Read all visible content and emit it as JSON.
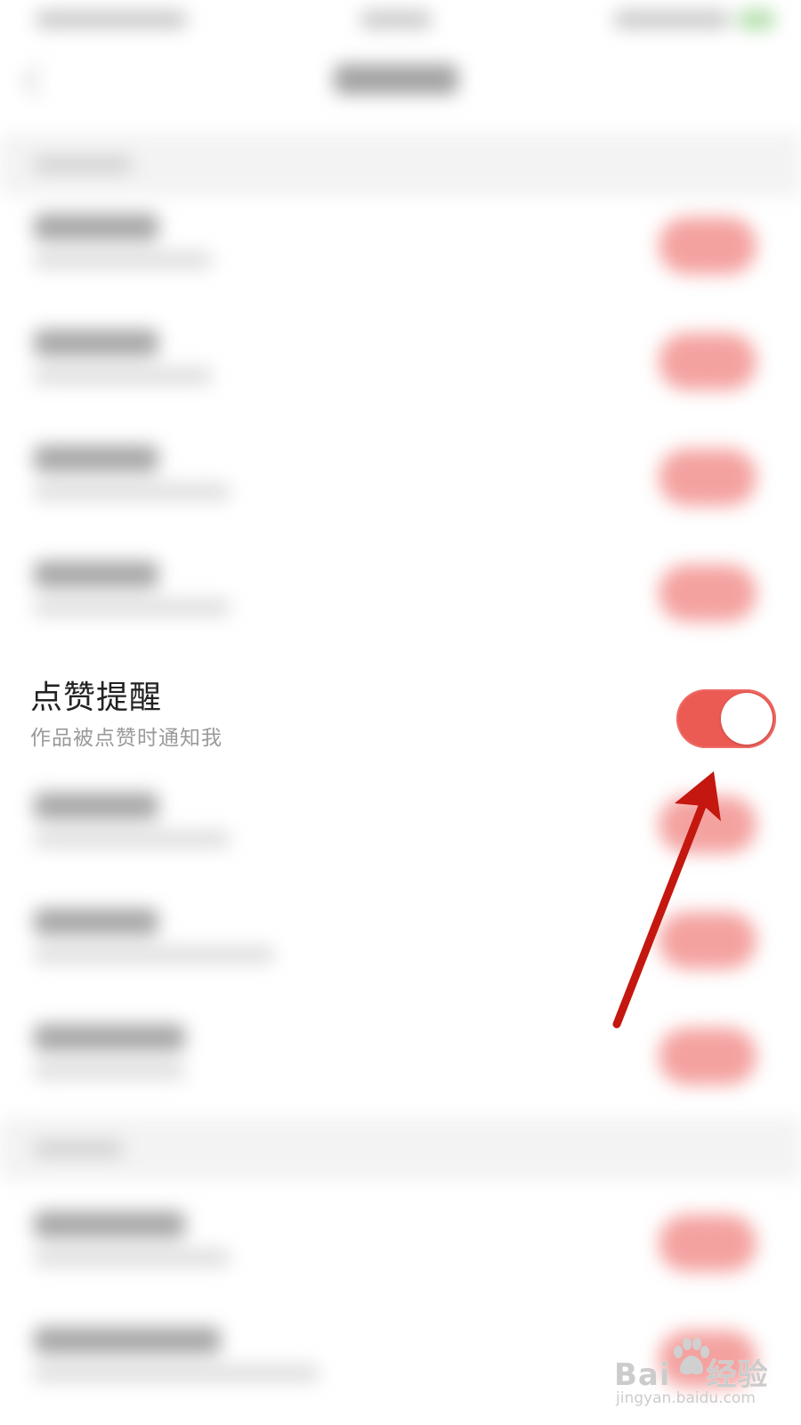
{
  "setting": {
    "title": "点赞提醒",
    "subtitle": "作品被点赞时通知我",
    "enabled": true
  },
  "colors": {
    "toggle_on": "#ec5a54",
    "arrow": "#c4170f",
    "title_text": "#222222",
    "subtitle_text": "#9a9a9a"
  },
  "watermark": {
    "brand": "Bai",
    "brand_suffix": "经验",
    "url": "jingyan.baidu.com",
    "icon": "baidu-paw-icon"
  }
}
